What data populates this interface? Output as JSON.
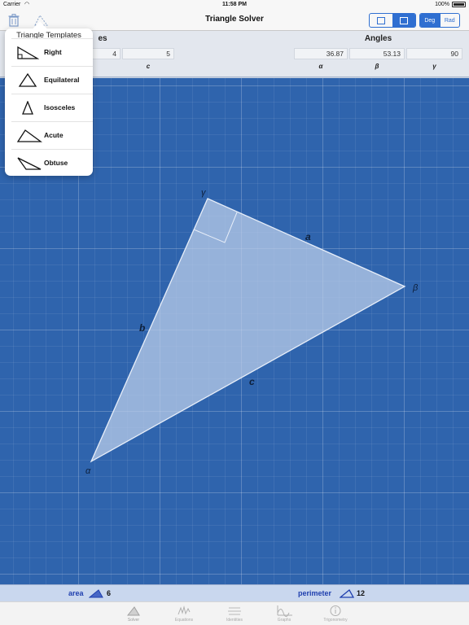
{
  "status_bar": {
    "carrier": "Carrier",
    "time": "11:58 PM",
    "battery": "100%"
  },
  "nav": {
    "title": "Triangle Solver",
    "unit_deg": "Deg",
    "unit_rad": "Rad",
    "selected_unit": "Deg"
  },
  "table": {
    "sides_header": "es",
    "angles_header": "Angles",
    "sides": {
      "b": "4",
      "c": "5"
    },
    "side_symbol_c": "c",
    "angles": {
      "alpha": "36.87",
      "beta": "53.13",
      "gamma": "90"
    },
    "angle_symbols": {
      "alpha": "α",
      "beta": "β",
      "gamma": "γ"
    }
  },
  "canvas": {
    "side_labels": {
      "a": "a",
      "b": "b",
      "c": "c"
    },
    "vertex_labels": {
      "alpha": "α",
      "beta": "β",
      "gamma": "γ"
    }
  },
  "footer": {
    "area_label": "area",
    "area_value": "6",
    "perimeter_label": "perimeter",
    "perimeter_value": "12"
  },
  "tabs": [
    {
      "label": "Solver",
      "icon": "triangle-icon"
    },
    {
      "label": "Equations",
      "icon": "equations-icon"
    },
    {
      "label": "Identities",
      "icon": "identities-icon"
    },
    {
      "label": "Graphs",
      "icon": "graph-icon"
    },
    {
      "label": "Trigonometry",
      "icon": "info-icon"
    }
  ],
  "templates": {
    "title": "Triangle Templates",
    "items": [
      {
        "label": "Right",
        "icon": "right-triangle-icon"
      },
      {
        "label": "Equilateral",
        "icon": "equilateral-triangle-icon"
      },
      {
        "label": "Isosceles",
        "icon": "isosceles-triangle-icon"
      },
      {
        "label": "Acute",
        "icon": "acute-triangle-icon"
      },
      {
        "label": "Obtuse",
        "icon": "obtuse-triangle-icon"
      }
    ]
  },
  "colors": {
    "accent": "#2f6fd1",
    "canvas": "#2f64ad",
    "triangle_fill": "#b5c9e6",
    "footer_label": "#1f3fae"
  }
}
